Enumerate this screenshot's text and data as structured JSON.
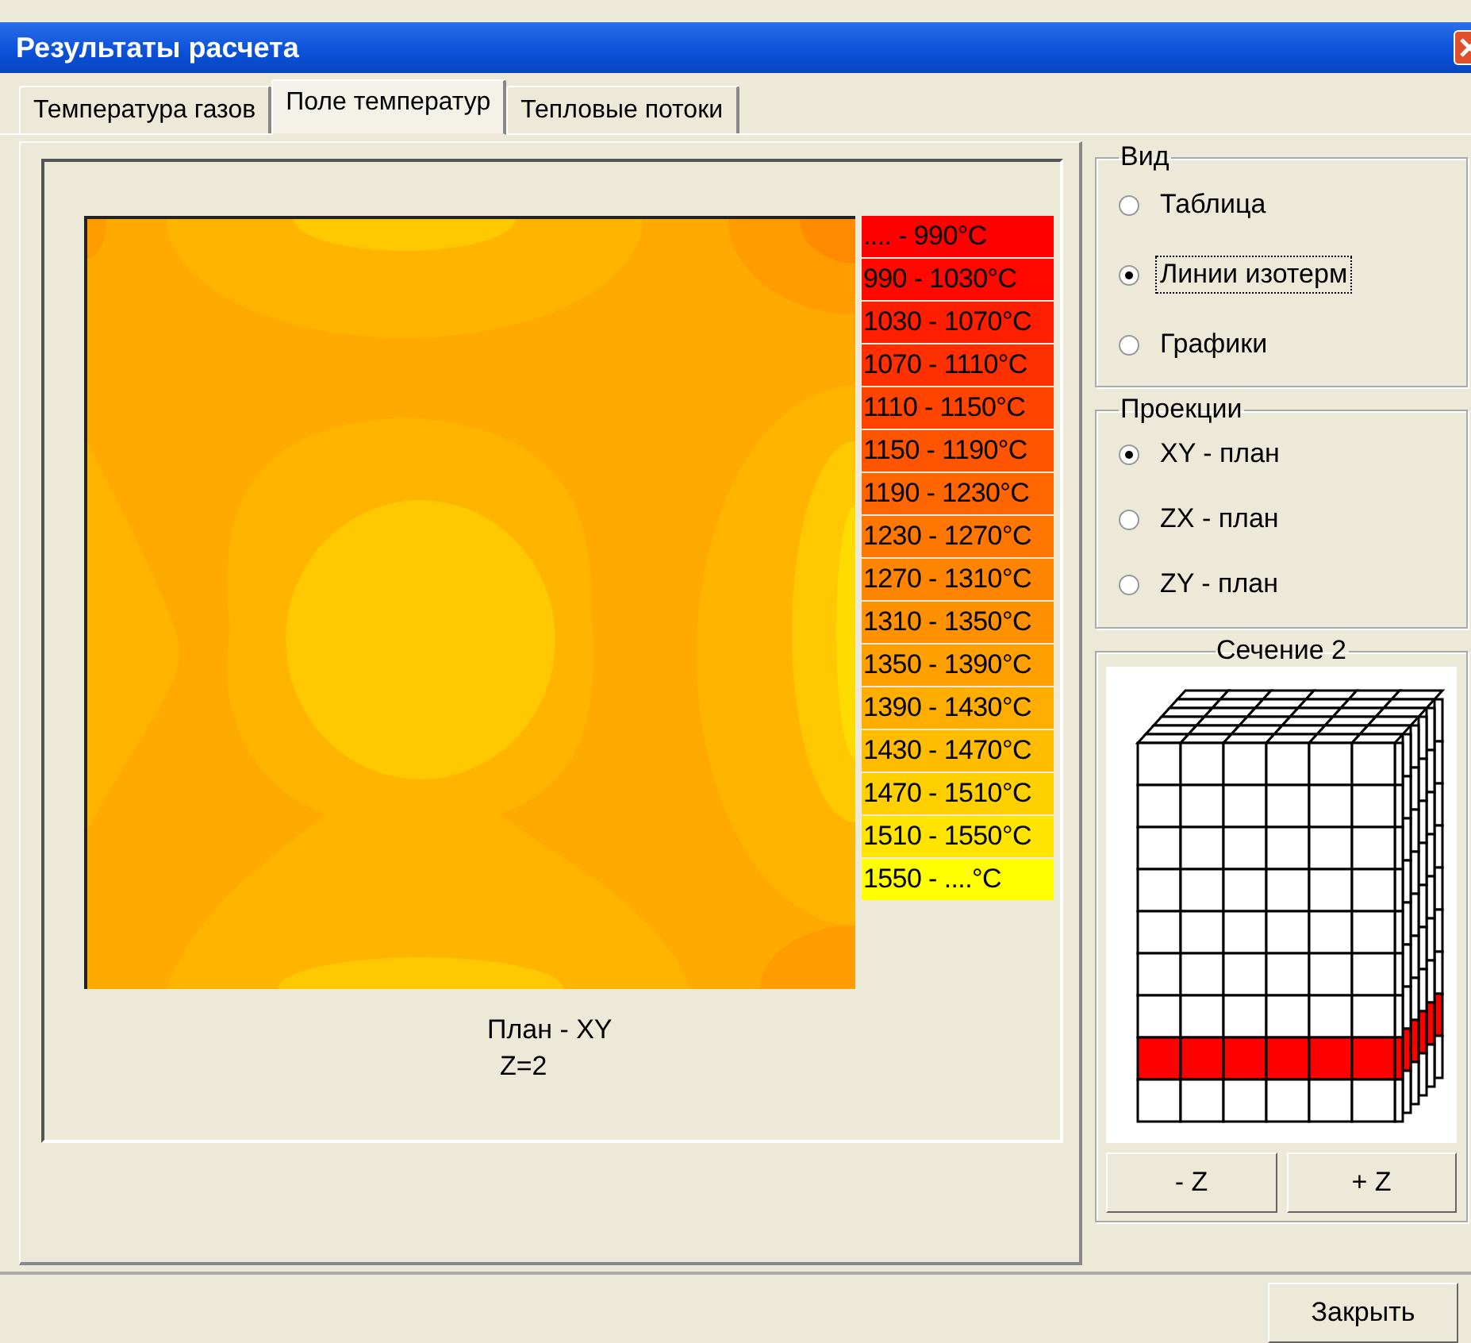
{
  "window": {
    "title": "Результаты расчета"
  },
  "tabs": [
    {
      "label": "Температура газов",
      "selected": false
    },
    {
      "label": "Поле температур",
      "selected": true
    },
    {
      "label": "Тепловые потоки",
      "selected": false
    }
  ],
  "legend": [
    {
      "label": "....  -  990°C",
      "color": "#ff0000"
    },
    {
      "label": "990 - 1030°C",
      "color": "#ff0800"
    },
    {
      "label": "1030 - 1070°C",
      "color": "#ff1e00"
    },
    {
      "label": "1070 - 1110°C",
      "color": "#ff3000"
    },
    {
      "label": "1110 - 1150°C",
      "color": "#ff4400"
    },
    {
      "label": "1150 - 1190°C",
      "color": "#ff5500"
    },
    {
      "label": "1190 - 1230°C",
      "color": "#ff6600"
    },
    {
      "label": "1230 - 1270°C",
      "color": "#ff7700"
    },
    {
      "label": "1270 - 1310°C",
      "color": "#ff8400"
    },
    {
      "label": "1310 - 1350°C",
      "color": "#ff9100"
    },
    {
      "label": "1350 - 1390°C",
      "color": "#ffa000"
    },
    {
      "label": "1390 - 1430°C",
      "color": "#ffae00"
    },
    {
      "label": "1430 - 1470°C",
      "color": "#ffbc00"
    },
    {
      "label": "1470 - 1510°C",
      "color": "#ffd000"
    },
    {
      "label": "1510 - 1550°C",
      "color": "#ffe400"
    },
    {
      "label": "1550 - ....°C",
      "color": "#ffff00"
    }
  ],
  "caption": [
    "План - XY",
    "Z=2"
  ],
  "view_group": {
    "title": "Вид",
    "options": [
      {
        "label": "Таблица",
        "selected": false,
        "focused": false
      },
      {
        "label": "Линии изотерм",
        "selected": true,
        "focused": true
      },
      {
        "label": "Графики",
        "selected": false,
        "focused": false
      }
    ]
  },
  "projection_group": {
    "title": "Проекции",
    "options": [
      {
        "label": "XY - план",
        "selected": true
      },
      {
        "label": "ZX - план",
        "selected": false
      },
      {
        "label": "ZY - план",
        "selected": false
      }
    ]
  },
  "section_group": {
    "title": "Сечение 2",
    "buttons": [
      "- Z",
      "+ Z"
    ]
  },
  "close_button": "Закрыть"
}
